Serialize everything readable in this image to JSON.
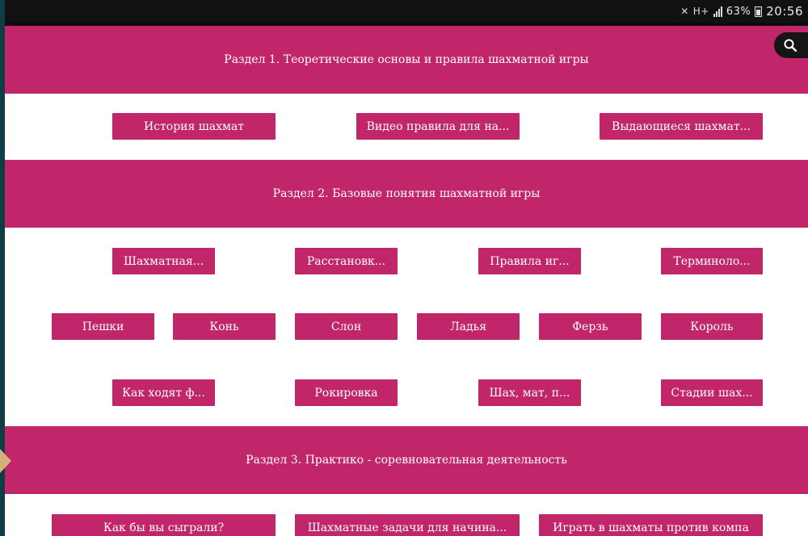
{
  "status_bar": {
    "battery": "63%",
    "time": "20:56",
    "network": "H+"
  },
  "sections": [
    {
      "title": "Раздел 1. Теоретические основы и правила шахматной игры",
      "buttons": [
        "История шахмат",
        "Видео правила для на...",
        "Выдающиеся шахмат..."
      ]
    },
    {
      "title": "Раздел 2. Базовые понятия шахматной игры",
      "buttons_row1": [
        "Шахматная...",
        "Расстановк...",
        "Правила иг...",
        "Терминоло..."
      ],
      "buttons_row2": [
        "Пешки",
        "Конь",
        "Слон",
        "Ладья",
        "Ферзь",
        "Король"
      ],
      "buttons_row3": [
        "Как ходят ф...",
        "Рокировка",
        "Шах, мат, п...",
        "Стадии шах..."
      ]
    },
    {
      "title": "Раздел 3. Практико - соревновательная деятельность",
      "buttons": [
        "Как бы вы сыграли?",
        "Шахматные задачи для начина...",
        "Играть в шахматы против компа"
      ]
    }
  ],
  "icons": {
    "search": "search-icon"
  }
}
